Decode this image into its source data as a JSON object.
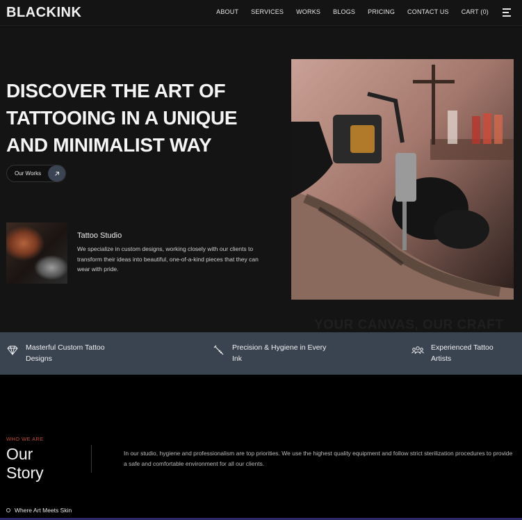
{
  "nav": {
    "logo": "BLACKINK",
    "items": [
      {
        "label": "ABOUT"
      },
      {
        "label": "SERVICES"
      },
      {
        "label": "WORKS"
      },
      {
        "label": "BLOGS"
      },
      {
        "label": "PRICING"
      },
      {
        "label": "CONTACT US"
      },
      {
        "label": "CART (0)"
      }
    ],
    "menu_icon": "hamburger-icon"
  },
  "hero": {
    "title": "DISCOVER THE ART OF TATTOOING IN A UNIQUE AND MINIMALIST WAY",
    "cta_label": "Our Works",
    "cta_icon": "arrow-up-right-icon",
    "studio_title": "Tattoo Studio",
    "studio_text": "We specialize in custom designs, working closely with our clients to transform their ideas into beautiful, one-of-a-kind pieces that they can wear with pride.",
    "watermark": "YOUR CANVAS, OUR CRAFT"
  },
  "features": [
    {
      "icon": "heart-diamond-icon",
      "label": "Masterful Custom Tattoo Designs"
    },
    {
      "icon": "tattoo-needle-icon",
      "label": "Precision & Hygiene in Every Ink"
    },
    {
      "icon": "people-group-icon",
      "label": "Experienced Tattoo Artists"
    }
  ],
  "about": {
    "eyebrow": "WHO WE ARE",
    "title_line1": "Our",
    "title_line2": "Story",
    "text": "In our studio, hygiene and professionalism are top priorities. We use the highest quality equipment and follow strict sterilization procedures to provide a safe and comfortable environment for all our clients.",
    "bullet": "Where Art Meets Skin"
  },
  "colors": {
    "background": "#141414",
    "feature_bar": "#3a4350",
    "accent": "#c04a3a",
    "cta_arrow_bg": "#3b4452"
  }
}
